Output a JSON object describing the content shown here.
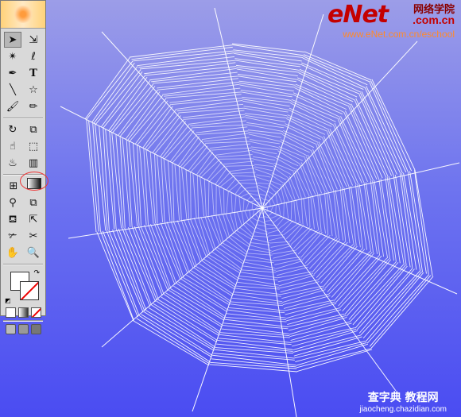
{
  "toolbox": {
    "tools": [
      [
        "selection-tool",
        "direct-selection-tool"
      ],
      [
        "magic-wand-tool",
        "lasso-tool"
      ],
      [
        "pen-tool",
        "type-tool"
      ],
      [
        "line-segment-tool",
        "star-tool"
      ],
      [
        "paintbrush-tool",
        "pencil-tool"
      ],
      [
        "rotate-tool",
        "scale-tool"
      ],
      [
        "warp-tool",
        "free-transform-tool"
      ],
      [
        "symbol-sprayer-tool",
        "column-graph-tool"
      ],
      [
        "mesh-tool",
        "gradient-tool"
      ],
      [
        "eyedropper-tool",
        "blend-tool"
      ],
      [
        "live-paint-bucket-tool",
        "live-paint-selection-tool"
      ],
      [
        "slice-tool",
        "scissors-tool"
      ],
      [
        "hand-tool",
        "zoom-tool"
      ]
    ],
    "type_glyph": "T"
  },
  "brand": {
    "logo": "eNet",
    "logo_suffix": ".com.cn",
    "cn_name": "网络学院",
    "url": "www.eNet.com.cn/eschool"
  },
  "watermark": {
    "main": "查字典 教程网",
    "sub": "jiaocheng.chazidian.com"
  },
  "colors": {
    "canvas_top": "#9c9de8",
    "canvas_bottom": "#4a4cf2",
    "web_stroke": "#ffffff"
  }
}
